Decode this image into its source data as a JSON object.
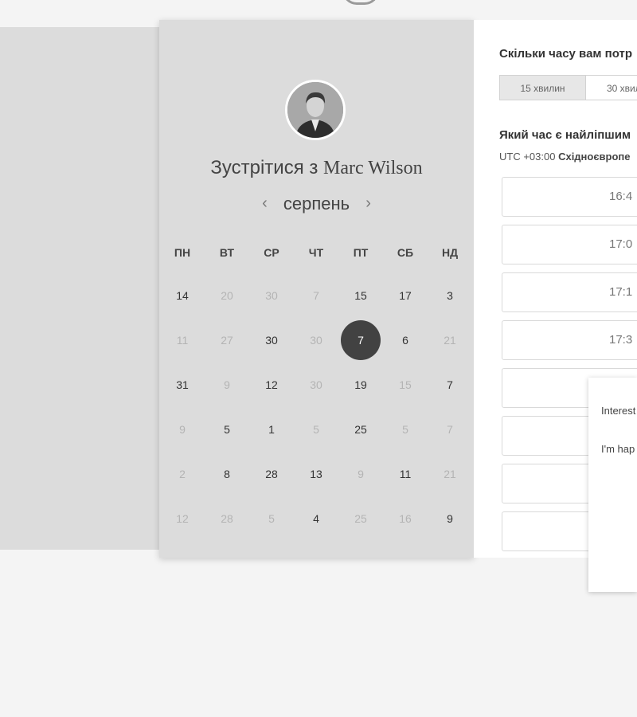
{
  "scheduler": {
    "title_prefix": "Зустрітися з",
    "host_name": "Marc Wilson",
    "calendar": {
      "month": "серпень",
      "prev_arrow": "‹",
      "next_arrow": "›",
      "weekdays": [
        "ПН",
        "ВТ",
        "СР",
        "ЧТ",
        "ПТ",
        "СБ",
        "НД"
      ],
      "weeks": [
        [
          {
            "d": "14",
            "a": true
          },
          {
            "d": "20",
            "a": false
          },
          {
            "d": "30",
            "a": false
          },
          {
            "d": "7",
            "a": false
          },
          {
            "d": "15",
            "a": true
          },
          {
            "d": "17",
            "a": true
          },
          {
            "d": "3",
            "a": true
          }
        ],
        [
          {
            "d": "11",
            "a": false
          },
          {
            "d": "27",
            "a": false
          },
          {
            "d": "30",
            "a": true
          },
          {
            "d": "30",
            "a": false
          },
          {
            "d": "7",
            "a": true,
            "selected": true
          },
          {
            "d": "6",
            "a": true
          },
          {
            "d": "21",
            "a": false
          }
        ],
        [
          {
            "d": "31",
            "a": true
          },
          {
            "d": "9",
            "a": false
          },
          {
            "d": "12",
            "a": true
          },
          {
            "d": "30",
            "a": false
          },
          {
            "d": "19",
            "a": true
          },
          {
            "d": "15",
            "a": false
          },
          {
            "d": "7",
            "a": true
          }
        ],
        [
          {
            "d": "9",
            "a": false
          },
          {
            "d": "5",
            "a": true
          },
          {
            "d": "1",
            "a": true
          },
          {
            "d": "5",
            "a": false
          },
          {
            "d": "25",
            "a": true
          },
          {
            "d": "5",
            "a": false
          },
          {
            "d": "7",
            "a": false
          }
        ],
        [
          {
            "d": "2",
            "a": false
          },
          {
            "d": "8",
            "a": true
          },
          {
            "d": "28",
            "a": true
          },
          {
            "d": "13",
            "a": true
          },
          {
            "d": "9",
            "a": false
          },
          {
            "d": "11",
            "a": true
          },
          {
            "d": "21",
            "a": false
          }
        ],
        [
          {
            "d": "12",
            "a": false
          },
          {
            "d": "28",
            "a": false
          },
          {
            "d": "5",
            "a": false
          },
          {
            "d": "4",
            "a": true
          },
          {
            "d": "25",
            "a": false
          },
          {
            "d": "16",
            "a": false
          },
          {
            "d": "9",
            "a": true
          }
        ]
      ]
    },
    "duration": {
      "question": "Скільки часу вам потр",
      "options": [
        {
          "label": "15 хвилин",
          "active": true
        },
        {
          "label": "30 хвил",
          "active": false
        }
      ]
    },
    "time": {
      "question": "Який час є найліпшим",
      "timezone_prefix": "UTC +03:00",
      "timezone_name": "Східноєвропе",
      "slots": [
        "16:4",
        "17:0",
        "17:1",
        "17:3",
        "",
        "",
        "",
        ""
      ]
    },
    "popup": {
      "paragraphs": [
        "Interest Manage departm",
        "I'm hap insight use our improve product"
      ]
    }
  },
  "colors": {
    "panel_bg": "#dcdcdc",
    "page_bg": "#f4f4f4",
    "selected_day": "#424242",
    "unavailable_day": "#b4b4b4"
  }
}
